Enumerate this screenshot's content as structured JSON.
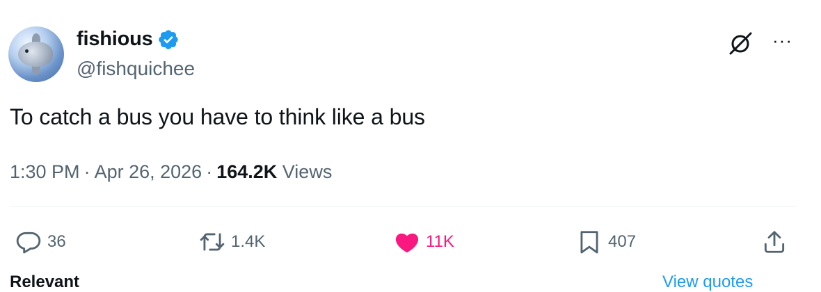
{
  "author": {
    "display_name": "fishious",
    "handle": "@fishquichee",
    "verified": true,
    "avatar_icon": "sunfish-avatar"
  },
  "header_actions": {
    "grok_icon": "grok-icon",
    "more_icon": "more-icon",
    "more_label": "···"
  },
  "tweet": {
    "text": "To catch a bus you have to think like a bus"
  },
  "meta": {
    "time": "1:30 PM",
    "date": "Apr 26, 2026",
    "views_count": "164.2K",
    "views_label": "Views",
    "separator": "·"
  },
  "actions": {
    "replies": "36",
    "retweets": "1.4K",
    "likes": "11K",
    "bookmarks": "407"
  },
  "colors": {
    "like_pink": "#f91880",
    "verified_blue": "#1d9bf0",
    "secondary_text": "#536471",
    "primary_text": "#0f1419"
  },
  "cut_off": {
    "left_label": "Relevant",
    "right_label": "View quotes"
  }
}
